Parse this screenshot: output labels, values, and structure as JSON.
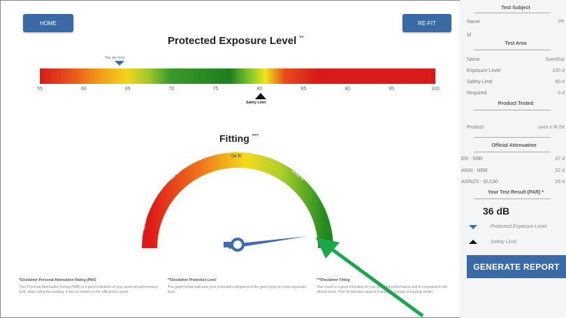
{
  "header": {
    "home_label": "HOME",
    "refit_label": "RE-FIT"
  },
  "exposure": {
    "title": "Protected Exposure Level",
    "title_mark": "**",
    "you_are_here": "You are here",
    "ticks": [
      "55",
      "60",
      "65",
      "70",
      "75",
      "80",
      "85",
      "90",
      "95",
      "100"
    ],
    "safety_label": "Safety Limit"
  },
  "fitting": {
    "title": "Fitting",
    "title_mark": "***",
    "labels": {
      "no_fit": "No fit",
      "poor_fit": "Poor fit",
      "ok_fit": "Ok fit",
      "good_fit": "Good fit",
      "perfect_fit": "Perfect fit"
    }
  },
  "disclaimers": [
    {
      "title": "*Disclaimer Personal Attenuation Rating (PAR)",
      "text": "Your Personal Attenuation Rating (PAR) is a good indication of your personal performance at fit, when using the earplug, it has no relation to the official test result."
    },
    {
      "title": "**Disclaimer Protection Level",
      "text": "The graph below indicates your protection compared to the given input on noise exposure level."
    },
    {
      "title": "***Disclaimer Fitting",
      "text": "Your result is a good indication of your personal performance and fit compared to the official result. Poor fit indicates need of training or change of earplug model."
    }
  ],
  "sidebar": {
    "test_subject_head": "Test Subject",
    "name_label": "Name",
    "name_value": "PF",
    "id_label": "Id",
    "test_area_head": "Test Area",
    "area_name_label": "Name",
    "area_name_value": "SwedSal",
    "exposure_label": "Exposure Level",
    "exposure_value": "100 d",
    "safety_label": "Safety Limit",
    "safety_value": "80 d",
    "required_label": "Required",
    "required_value": "0 d",
    "product_head": "Product Tested",
    "product_label": "Product",
    "product_value": "uvex x-fit (M",
    "official_head": "Official Attenuation",
    "snr_label": "EN - SNR",
    "snr_value": "37 d",
    "nrr_label": "ANSI - NRR",
    "nrr_value": "32 d",
    "slc_label": "AS/NZS - SLC80",
    "slc_value": "26 d",
    "par_head": "Your Test Result (PAR) *",
    "par_value": "36 dB",
    "legend_pel": "Protected Exposure Level",
    "legend_safety": "Safety Limit",
    "generate_label": "GENERATE REPORT"
  },
  "colors": {
    "accent": "#3a6aa6",
    "annotation_arrow": "#1aa84a"
  }
}
